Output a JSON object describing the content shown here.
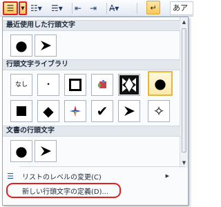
{
  "ribbon": {
    "bullets_icon": "bullet-list-icon",
    "numbering_icon": "numbered-list-icon",
    "multilevel_icon": "multilevel-list-icon",
    "style_sample_text": "あア"
  },
  "dropdown": {
    "recent_heading": "最近使用した行頭文字",
    "library_heading": "行頭文字ライブラリ",
    "document_heading": "文書の行頭文字",
    "none_label": "なし",
    "change_level_label": "リストのレベルの変更(C)",
    "define_new_label": "新しい行頭文字の定義(D)...",
    "selected_color": "#e6b53b",
    "highlight_color": "#e0201a"
  }
}
